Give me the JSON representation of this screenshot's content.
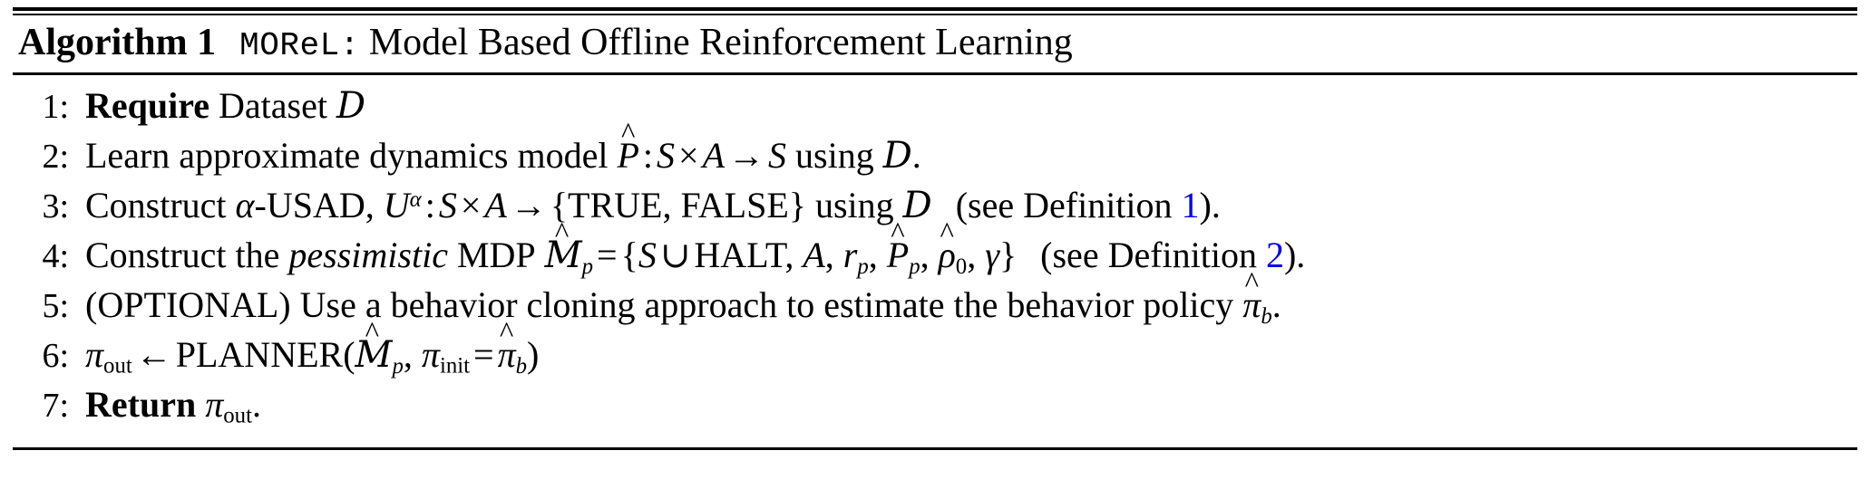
{
  "algorithm": {
    "label": "Algorithm 1",
    "name": "MOReL:",
    "title": "Model Based Offline Reinforcement Learning",
    "lines": [
      {
        "number": "1:",
        "keyword": "Require",
        "text": "Dataset",
        "symbol": "D",
        "plain": "1: Require Dataset D"
      },
      {
        "number": "2:",
        "text_before": "Learn approximate dynamics model",
        "symbol": "P",
        "colon": ":",
        "domain_s": "S",
        "times": "×",
        "domain_a": "A",
        "arrow": "→",
        "codomain": "S",
        "text_after": "using",
        "dataset": "D",
        "period": ".",
        "plain": "2: Learn approximate dynamics model P̂ : S × A → S using D."
      },
      {
        "number": "3:",
        "text_before": "Construct",
        "alpha": "α",
        "usad": "-USAD,",
        "symbol": "U",
        "sup": "α",
        "colon": ":",
        "domain_s": "S",
        "times": "×",
        "domain_a": "A",
        "arrow": "→",
        "set_open": "{",
        "true_label": "TRUE",
        "comma": ",",
        "false_label": "FALSE",
        "set_close": "}",
        "text_after": "using",
        "dataset": "D",
        "note_open": "(see Definition",
        "ref": "1",
        "note_close": ").",
        "plain": "3: Construct α-USAD, U^α : S × A → {TRUE, FALSE} using D  (see Definition 1)."
      },
      {
        "number": "4:",
        "text_before": "Construct the",
        "emph": "pessimistic",
        "mdp": "MDP",
        "symbol": "M",
        "sub": "p",
        "equals": "=",
        "set_open": "{",
        "state_s": "S",
        "cup": "∪",
        "halt": "HALT",
        "comma1": ",",
        "action_a": "A",
        "comma2": ",",
        "reward_r": "r",
        "reward_sub": "p",
        "comma3": ",",
        "model_p": "P",
        "model_sub": "p",
        "comma4": ",",
        "rho": "ρ",
        "rho_sub": "0",
        "comma5": ",",
        "gamma": "γ",
        "set_close": "}",
        "note_open": "(see Definition",
        "ref": "2",
        "note_close": ").",
        "plain": "4: Construct the pessimistic MDP M̂_p = {S ∪ HALT, A, r_p, P̂_p, ρ̂0, γ}  (see Definition 2)."
      },
      {
        "number": "5:",
        "text_before": "(OPTIONAL) Use a behavior cloning approach to estimate the behavior policy",
        "symbol": "π",
        "sub": "b",
        "period": ".",
        "plain": "5: (OPTIONAL) Use a behavior cloning approach to estimate the behavior policy π̂_b."
      },
      {
        "number": "6:",
        "symbol": "π",
        "sub": "out",
        "arrow": "←",
        "planner": "PLANNER(",
        "mdp": "M",
        "mdp_sub": "p",
        "comma": ",",
        "pi_init": "π",
        "pi_init_sub": "init",
        "equals": "=",
        "pi_b": "π",
        "pi_b_sub": "b",
        "close": ")",
        "plain": "6: π_out ← PLANNER(M̂_p, π_init = π̂_b)"
      },
      {
        "number": "7:",
        "keyword": "Return",
        "symbol": "π",
        "sub": "out",
        "period": ".",
        "plain": "7: Return π_out."
      }
    ]
  },
  "colors": {
    "text": "#000000",
    "link": "#0000ee",
    "background": "#ffffff",
    "rule": "#000000"
  }
}
